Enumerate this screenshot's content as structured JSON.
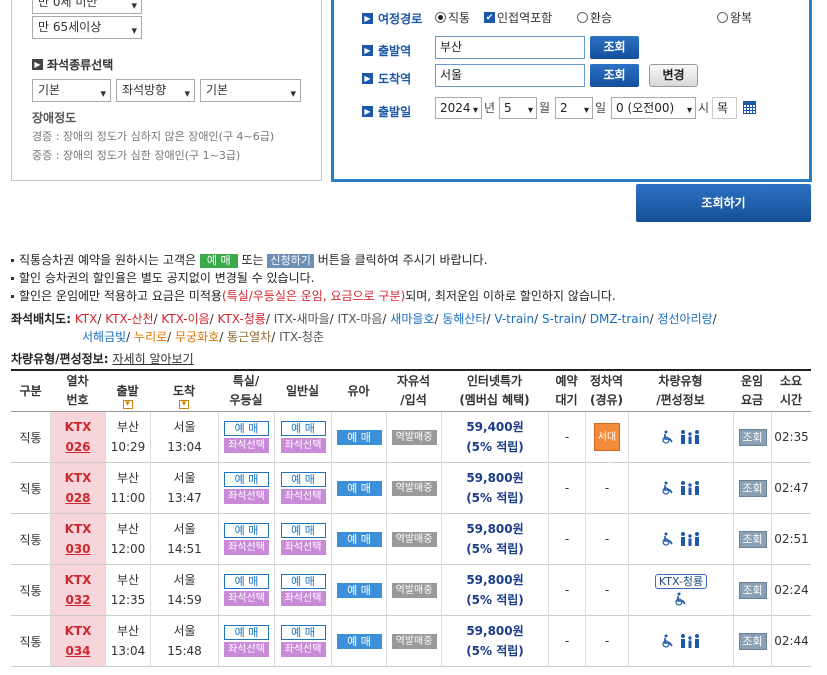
{
  "left_panel": {
    "discount_select_top": "만 0세 미만",
    "age_select": "만 65세이상",
    "seat_type_title": "좌석종류선택",
    "seat_selects": [
      "기본",
      "좌석방향",
      "기본"
    ],
    "disability_title": "장애정도",
    "disability_lines": [
      "경증 : 장애의 정도가 심하지 않은 장애인(구 4~6급)",
      "중증 : 장애의 정도가 심한 장애인(구 1~3급)"
    ]
  },
  "right_panel": {
    "route_label": "여정경로",
    "route_options": {
      "direct": "직통",
      "nearby": "인접역포함",
      "transfer": "환승",
      "roundtrip": "왕복"
    },
    "dep_label": "출발역",
    "dep_value": "부산",
    "arr_label": "도착역",
    "arr_value": "서울",
    "lookup_label": "조회",
    "change_label": "변경",
    "date_label": "출발일",
    "year": "2024",
    "year_unit": "년",
    "month": "5",
    "month_unit": "월",
    "day": "2",
    "day_unit": "일",
    "hour": "0 (오전00)",
    "hour_unit": "시",
    "weekday": "목"
  },
  "search_button": "조회하기",
  "notices": {
    "n1_pre": "직통승차권 예약을 원하시는 고객은",
    "n1_btn1": "예 매",
    "n1_mid": "또는",
    "n1_btn2": "신청하기",
    "n1_post": "버튼을 클릭하여 주시기 바랍니다.",
    "n2": "할인 승차권의 할인율은 별도 공지없이 변경될 수 있습니다.",
    "n3_pre": "할인은 운임에만 적용하고 요금은 미적용",
    "n3_red": "(특실/우등실은 운임, 요금으로 구분)",
    "n3_post": "되며, 최저운임 이하로 할인하지 않습니다."
  },
  "seat_layout": {
    "label": "좌석배치도:",
    "items": [
      {
        "text": "KTX",
        "color": "red"
      },
      {
        "text": "KTX-산천",
        "color": "red"
      },
      {
        "text": "KTX-이음",
        "color": "red"
      },
      {
        "text": "KTX-청룡",
        "color": "red"
      },
      {
        "text": "ITX-새마을",
        "color": "gray"
      },
      {
        "text": "ITX-마음",
        "color": "gray"
      },
      {
        "text": "새마을호",
        "color": "blue"
      },
      {
        "text": "동해산타",
        "color": "blue"
      },
      {
        "text": "V-train",
        "color": "blue"
      },
      {
        "text": "S-train",
        "color": "blue"
      },
      {
        "text": "DMZ-train",
        "color": "blue"
      },
      {
        "text": "정선아리랑",
        "color": "blue"
      },
      {
        "text": "서해금빛",
        "color": "blue"
      },
      {
        "text": "누리로",
        "color": "orange"
      },
      {
        "text": "무궁화호",
        "color": "orange"
      },
      {
        "text": "통근열차",
        "color": "brown"
      },
      {
        "text": "ITX-청춘",
        "color": "gray"
      }
    ]
  },
  "vehicle_info": {
    "label": "차량유형/편성정보:",
    "link": "자세히 알아보기"
  },
  "table": {
    "headers": {
      "type": "구분",
      "train": "열차\n번호",
      "dep": "출발",
      "arr": "도착",
      "special": "특실/\n우등실",
      "normal": "일반실",
      "infant": "유아",
      "standing": "자유석\n/입석",
      "internet": "인터넷특가\n(멤버십 혜택)",
      "waitlist": "예약\n대기",
      "stopover": "정차역\n(경유)",
      "vehicle": "차량유형\n/편성정보",
      "fare": "운임\n요금",
      "duration": "소요\n시간"
    },
    "labels": {
      "reserve": "예 매",
      "seat_select": "좌석선택",
      "infant_reserve": "예 매",
      "standing": "역발매중",
      "view": "조회",
      "dash": "-"
    },
    "rows": [
      {
        "type": "직통",
        "train_type": "KTX",
        "train_no": "026",
        "dep_station": "부산",
        "dep_time": "10:29",
        "arr_station": "서울",
        "arr_time": "13:04",
        "price": "59,400원",
        "earn": "(5% 적립)",
        "waitlist": "-",
        "stopover": "서대구",
        "vehicle_tag": "",
        "duration": "02:35"
      },
      {
        "type": "직통",
        "train_type": "KTX",
        "train_no": "028",
        "dep_station": "부산",
        "dep_time": "11:00",
        "arr_station": "서울",
        "arr_time": "13:47",
        "price": "59,800원",
        "earn": "(5% 적립)",
        "waitlist": "-",
        "stopover": "-",
        "vehicle_tag": "",
        "duration": "02:47"
      },
      {
        "type": "직통",
        "train_type": "KTX",
        "train_no": "030",
        "dep_station": "부산",
        "dep_time": "12:00",
        "arr_station": "서울",
        "arr_time": "14:51",
        "price": "59,800원",
        "earn": "(5% 적립)",
        "waitlist": "-",
        "stopover": "-",
        "vehicle_tag": "",
        "duration": "02:51"
      },
      {
        "type": "직통",
        "train_type": "KTX",
        "train_no": "032",
        "dep_station": "부산",
        "dep_time": "12:35",
        "arr_station": "서울",
        "arr_time": "14:59",
        "price": "59,800원",
        "earn": "(5% 적립)",
        "waitlist": "-",
        "stopover": "-",
        "vehicle_tag": "KTX-청룡",
        "duration": "02:24"
      },
      {
        "type": "직통",
        "train_type": "KTX",
        "train_no": "034",
        "dep_station": "부산",
        "dep_time": "13:04",
        "arr_station": "서울",
        "arr_time": "15:48",
        "price": "59,800원",
        "earn": "(5% 적립)",
        "waitlist": "-",
        "stopover": "-",
        "vehicle_tag": "",
        "duration": "02:44"
      }
    ]
  }
}
